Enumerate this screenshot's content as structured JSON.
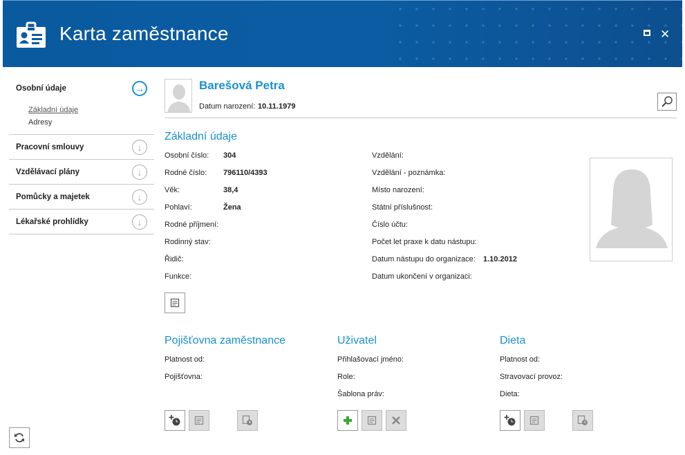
{
  "window": {
    "title": "Karta zaměstnance"
  },
  "sidebar": {
    "sections": [
      {
        "label": "Osobní údaje",
        "icon": "arrow-right-circle-icon",
        "subitems": [
          "Základní údaje",
          "Adresy"
        ]
      },
      {
        "label": "Pracovní smlouvy",
        "icon": "arrow-down-circle-icon"
      },
      {
        "label": "Vzdělávací plány",
        "icon": "arrow-down-circle-icon"
      },
      {
        "label": "Pomůcky a majetek",
        "icon": "arrow-down-circle-icon"
      },
      {
        "label": "Lékařské prohlídky",
        "icon": "arrow-down-circle-icon"
      }
    ]
  },
  "person": {
    "name": "Barešová Petra",
    "dob_label": "Datum narození:",
    "dob_value": "10.11.1979"
  },
  "basic": {
    "title": "Základní údaje",
    "left": [
      {
        "label": "Osobní číslo:",
        "value": "304"
      },
      {
        "label": "Rodné číslo:",
        "value": "796110/4393"
      },
      {
        "label": "Věk:",
        "value": "38,4"
      },
      {
        "label": "Pohlaví:",
        "value": "Žena"
      },
      {
        "label": "Rodné příjmení:",
        "value": ""
      },
      {
        "label": "Rodinný stav:",
        "value": ""
      },
      {
        "label": "Řidič:",
        "value": ""
      },
      {
        "label": "Funkce:",
        "value": ""
      }
    ],
    "right": [
      {
        "label": "Vzdělání:",
        "value": ""
      },
      {
        "label": "Vzdělání - poznámka:",
        "value": ""
      },
      {
        "label": "Místo narození:",
        "value": ""
      },
      {
        "label": "Státní příslušnost:",
        "value": ""
      },
      {
        "label": "Číslo účtu:",
        "value": ""
      },
      {
        "label": "Počet let praxe k datu nástupu:",
        "value": ""
      },
      {
        "label": "Datum nástupu do organizace:",
        "value": "1.10.2012"
      },
      {
        "label": "Datum ukončení v organizaci:",
        "value": ""
      }
    ]
  },
  "insurance": {
    "title": "Pojišťovna zaměstnance",
    "fields": [
      "Platnost od:",
      "Pojišťovna:"
    ]
  },
  "user": {
    "title": "Uživatel",
    "fields": [
      "Přihlašovací jméno:",
      "Role:",
      "Šablona práv:"
    ]
  },
  "diet": {
    "title": "Dieta",
    "fields": [
      "Platnost od:",
      "Stravovací provoz:",
      "Dieta:"
    ]
  },
  "colors": {
    "accent": "#1a8fd0",
    "header": "#0b5ca2",
    "add_green": "#3aa52e"
  }
}
